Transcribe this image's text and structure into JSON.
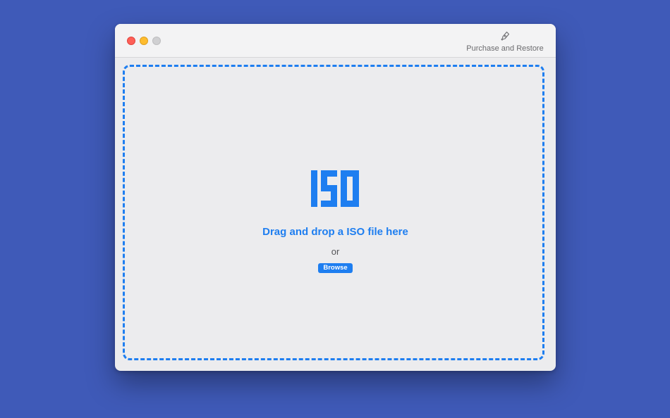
{
  "window": {
    "traffic_lights": [
      "close",
      "minimize",
      "zoom"
    ]
  },
  "toolbar": {
    "purchase_icon": "pen-nib-icon",
    "purchase_label": "Purchase and Restore"
  },
  "dropzone": {
    "logo_text": "ISO",
    "instruction": "Drag and drop a ISO file here",
    "separator": "or",
    "browse_label": "Browse"
  },
  "colors": {
    "background": "#3f5ab8",
    "accent": "#1e7ef0",
    "window": "#ececee"
  }
}
